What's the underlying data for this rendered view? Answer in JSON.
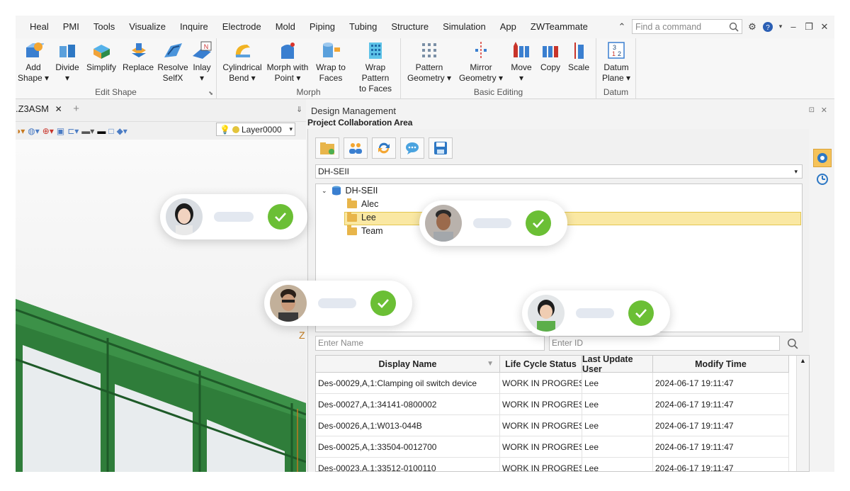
{
  "menu": [
    "Heal",
    "PMI",
    "Tools",
    "Visualize",
    "Inquire",
    "Electrode",
    "Mold",
    "Piping",
    "Tubing",
    "Structure",
    "Simulation",
    "App",
    "ZWTeammate"
  ],
  "search": {
    "placeholder": "Find a command"
  },
  "ribbon": {
    "groups": [
      {
        "title": "Edit Shape",
        "buttons": [
          "Add\nShape ▾",
          "Divide\n▾",
          "Simplify",
          "Replace",
          "Resolve\nSelfX",
          "Inlay\n▾"
        ]
      },
      {
        "title": "Morph",
        "buttons": [
          "Cylindrical\nBend ▾",
          "Morph with\nPoint ▾",
          "Wrap to\nFaces",
          "Wrap Pattern\nto Faces"
        ]
      },
      {
        "title": "Basic Editing",
        "buttons": [
          "Pattern\nGeometry ▾",
          "Mirror\nGeometry ▾",
          "Move\n▾",
          "Copy",
          "Scale"
        ]
      },
      {
        "title": "Datum",
        "buttons": [
          "Datum\nPlane ▾"
        ]
      }
    ]
  },
  "document": {
    "tab": ".Z3ASM",
    "layer": "Layer0000",
    "axis_label": "Z"
  },
  "design_management": {
    "title": "Design Management",
    "subtitle": "Project Collaboration Area",
    "project": "DH-SEII",
    "tree": {
      "root": "DH-SEII",
      "children": [
        "Alec",
        "Lee",
        "Team"
      ],
      "selected": "Lee"
    },
    "filters": {
      "name_placeholder": "Enter Name",
      "id_placeholder": "Enter ID"
    },
    "columns": [
      "Display Name",
      "Life Cycle Status",
      "Last Update User",
      "Modify Time"
    ],
    "rows": [
      [
        "Des-00029,A,1:Clamping oil switch device",
        "WORK IN PROGRESS",
        "Lee",
        "2024-06-17 19:11:47"
      ],
      [
        "Des-00027,A,1:34141-0800002",
        "WORK IN PROGRESS",
        "Lee",
        "2024-06-17 19:11:47"
      ],
      [
        "Des-00026,A,1:W013-044B",
        "WORK IN PROGRESS",
        "Lee",
        "2024-06-17 19:11:47"
      ],
      [
        "Des-00025,A,1:33504-0012700",
        "WORK IN PROGRESS",
        "Lee",
        "2024-06-17 19:11:47"
      ],
      [
        "Des-00023,A,1:33512-0100110",
        "WORK IN PROGRESS",
        "Lee",
        "2024-06-17 19:11:47"
      ]
    ]
  },
  "colors": {
    "accent_green": "#6bbf35",
    "selection": "#fae8a3",
    "model_green": "#2f7d3a"
  }
}
